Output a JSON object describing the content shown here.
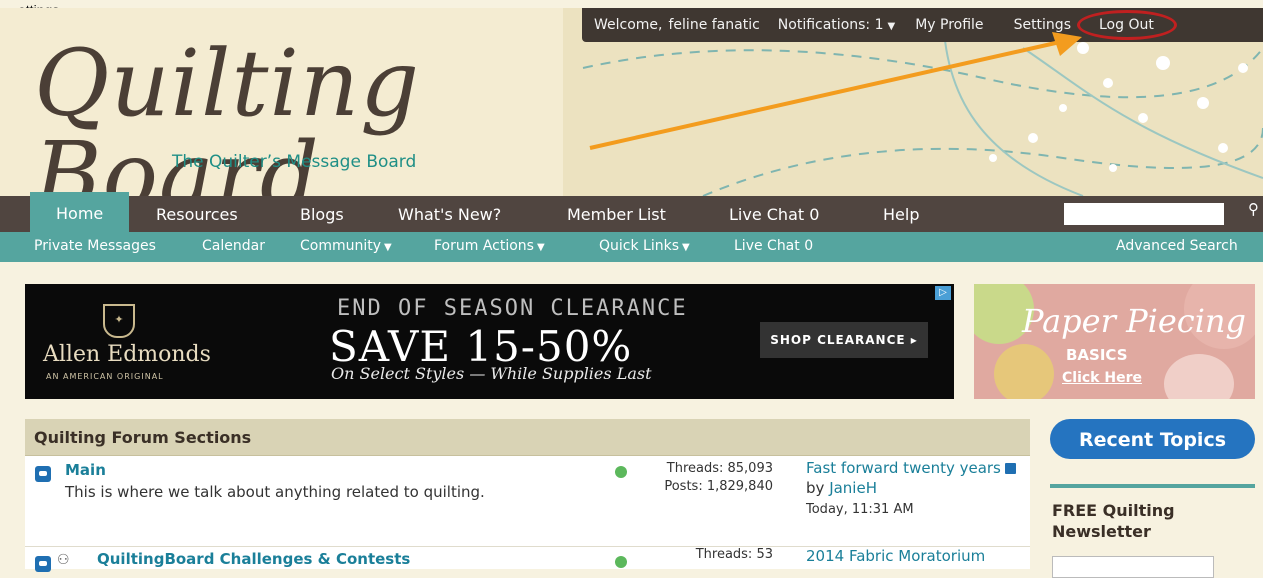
{
  "snippet_label": "…ettings",
  "topbar": {
    "welcome": "Welcome,",
    "username": "feline fanatic",
    "notifications": "Notifications: 1",
    "my_profile": "My Profile",
    "settings": "Settings",
    "logout": "Log Out"
  },
  "logo": {
    "script": "Quilting Board",
    "tagline": "The Quilter’s Message Board"
  },
  "main_nav": [
    "Home",
    "Resources",
    "Blogs",
    "What's New?",
    "Member List",
    "Live Chat 0",
    "Help"
  ],
  "sub_nav": {
    "items": [
      "Private Messages",
      "Calendar",
      "Community",
      "Forum Actions",
      "Quick Links",
      "Live Chat 0"
    ],
    "advanced_search": "Advanced Search"
  },
  "ad_main": {
    "brand": "Allen Edmonds",
    "brand_sub": "AN AMERICAN ORIGINAL",
    "headline": "END OF SEASON CLEARANCE",
    "big": "SAVE 15-50%",
    "sub": "On Select Styles — While Supplies Last",
    "cta": "SHOP CLEARANCE ▸"
  },
  "ad_side": {
    "title": "Paper Piecing",
    "sub": "BASICS",
    "cta": "Click Here"
  },
  "forum": {
    "section_title": "Quilting Forum Sections",
    "rows": [
      {
        "title": "Main",
        "description": "This is where we talk about anything related to quilting.",
        "threads": "Threads: 85,093",
        "posts": "Posts: 1,829,840",
        "last_title": "Fast forward twenty years",
        "by": "by",
        "last_user": "JanieH",
        "last_date": "Today, 11:31 AM"
      },
      {
        "title": "QuiltingBoard Challenges & Contests",
        "threads": "Threads: 53",
        "last_title": "2014 Fabric Moratorium"
      }
    ]
  },
  "sidebar": {
    "recent_topics": "Recent Topics",
    "newsletter": "FREE Quilting Newsletter"
  }
}
